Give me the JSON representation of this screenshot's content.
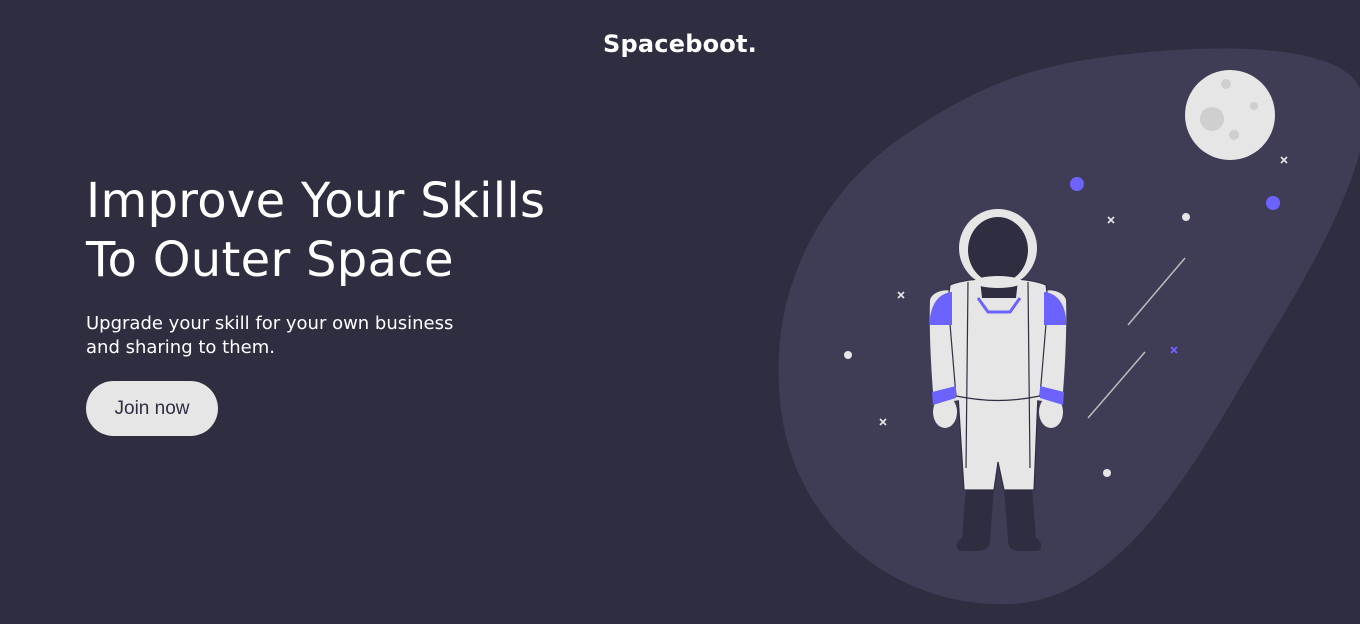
{
  "header": {
    "logo": "Spaceboot."
  },
  "hero": {
    "title_line1": "Improve Your Skills",
    "title_line2": "To Outer Space",
    "subtitle_line1": "Upgrade your skill for your own business",
    "subtitle_line2": "and sharing to them.",
    "cta_label": "Join now"
  },
  "colors": {
    "background": "#2f2e41",
    "blob": "#3f3d56",
    "accent": "#6c63ff",
    "suit": "#e6e6e6",
    "button_bg": "#e6e6e6"
  },
  "illustration": {
    "icons": [
      "moon-icon",
      "astronaut-icon",
      "star-icon",
      "shooting-star-icon"
    ]
  }
}
